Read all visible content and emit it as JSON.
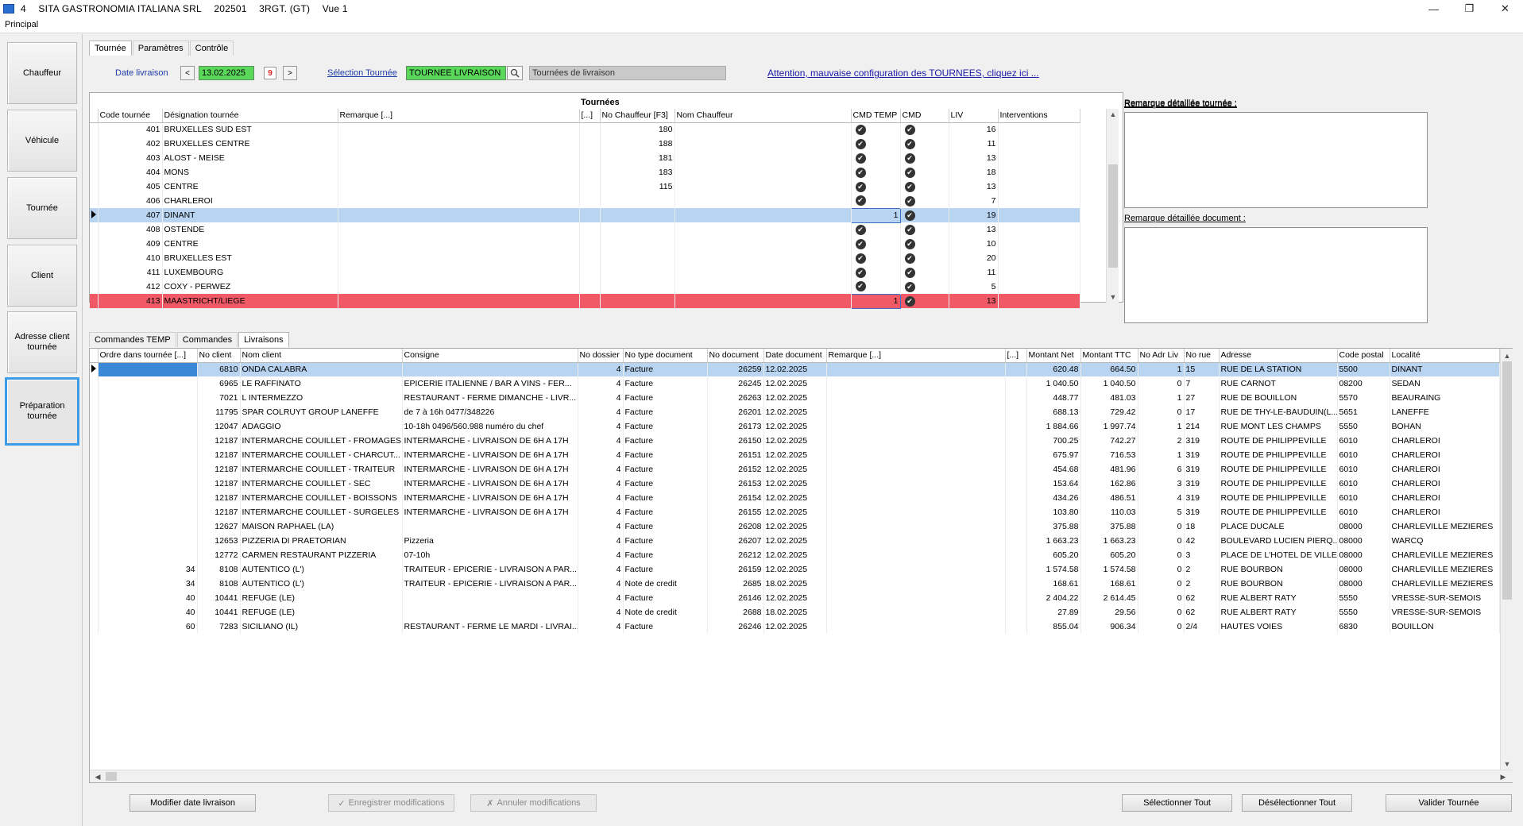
{
  "window": {
    "number": "4",
    "company": "SITA GASTRONOMIA ITALIANA SRL",
    "code": "202501",
    "region": "3RGT. (GT)",
    "view": "Vue 1"
  },
  "menu": {
    "main": "Principal"
  },
  "sidebar": {
    "items": [
      {
        "label": "Chauffeur"
      },
      {
        "label": "Véhicule"
      },
      {
        "label": "Tournée"
      },
      {
        "label": "Client"
      },
      {
        "label": "Adresse client tournée"
      },
      {
        "label": "Préparation tournée"
      }
    ]
  },
  "top_tabs": [
    {
      "label": "Tournée"
    },
    {
      "label": "Paramètres"
    },
    {
      "label": "Contrôle"
    }
  ],
  "filters": {
    "date_label": "Date livraison",
    "date_value": "13.02.2025",
    "prev": "<",
    "next": ">",
    "cal": "9",
    "selection_label": "Sélection Tournée",
    "tournee_value": "TOURNEE LIVRAISON",
    "tournee_desc": "Tournées de livraison",
    "warning": "Attention, mauvaise configuration des TOURNEES, cliquez ici ..."
  },
  "tournees": {
    "title": "Tournées",
    "columns": [
      "Code tournée",
      "Désignation tournée",
      "Remarque [...]",
      "[...]",
      "No Chauffeur [F3]",
      "Nom Chauffeur",
      "CMD TEMP",
      "CMD",
      "LIV",
      "Interventions"
    ],
    "rows": [
      {
        "code": "401",
        "name": "BRUXELLES SUD EST",
        "chauffeur": "180",
        "cmd_temp": "✔",
        "cmd": "✔",
        "liv": "16"
      },
      {
        "code": "402",
        "name": "BRUXELLES CENTRE",
        "chauffeur": "188",
        "cmd_temp": "✔",
        "cmd": "✔",
        "liv": "11"
      },
      {
        "code": "403",
        "name": "ALOST - MEISE",
        "chauffeur": "181",
        "cmd_temp": "✔",
        "cmd": "✔",
        "liv": "13"
      },
      {
        "code": "404",
        "name": "MONS",
        "chauffeur": "183",
        "cmd_temp": "✔",
        "cmd": "✔",
        "liv": "18"
      },
      {
        "code": "405",
        "name": "CENTRE",
        "chauffeur": "115",
        "cmd_temp": "✔",
        "cmd": "✔",
        "liv": "13"
      },
      {
        "code": "406",
        "name": "CHARLEROI",
        "chauffeur": "",
        "cmd_temp": "✔",
        "cmd": "✔",
        "liv": "7"
      },
      {
        "code": "407",
        "name": "DINANT",
        "chauffeur": "",
        "cmd_temp": "1",
        "cmd": "✔",
        "liv": "19"
      },
      {
        "code": "408",
        "name": "OSTENDE",
        "chauffeur": "",
        "cmd_temp": "✔",
        "cmd": "✔",
        "liv": "13"
      },
      {
        "code": "409",
        "name": "CENTRE",
        "chauffeur": "",
        "cmd_temp": "✔",
        "cmd": "✔",
        "liv": "10"
      },
      {
        "code": "410",
        "name": "BRUXELLES EST",
        "chauffeur": "",
        "cmd_temp": "✔",
        "cmd": "✔",
        "liv": "20"
      },
      {
        "code": "411",
        "name": "LUXEMBOURG",
        "chauffeur": "",
        "cmd_temp": "✔",
        "cmd": "✔",
        "liv": "11"
      },
      {
        "code": "412",
        "name": "COXY - PERWEZ",
        "chauffeur": "",
        "cmd_temp": "✔",
        "cmd": "✔",
        "liv": "5"
      },
      {
        "code": "413",
        "name": "MAASTRICHT/LIEGE",
        "chauffeur": "",
        "cmd_temp": "1",
        "cmd": "✔",
        "liv": "13"
      }
    ],
    "selected_index": 6,
    "alert_index": 12
  },
  "remarks": {
    "tournee_label": "Remarque détaillée tournée :",
    "document_label": "Remarque détaillée document :"
  },
  "bottom_tabs": [
    {
      "label": "Commandes TEMP"
    },
    {
      "label": "Commandes"
    },
    {
      "label": "Livraisons"
    }
  ],
  "livraisons": {
    "columns": [
      "Ordre dans tournée [...]",
      "No client",
      "Nom client",
      "Consigne",
      "No dossier",
      "No type document",
      "No document",
      "Date document",
      "Remarque [...]",
      "[...]",
      "Montant Net",
      "Montant TTC",
      "No Adr Liv",
      "No rue",
      "Adresse",
      "Code postal",
      "Localité"
    ],
    "rows": [
      {
        "ordre": "",
        "client": "6810",
        "nom": "ONDA CALABRA",
        "consigne": "",
        "dossier": "4",
        "type": "Facture",
        "doc": "26259",
        "date": "12.02.2025",
        "net": "620.48",
        "ttc": "664.50",
        "adr": "1",
        "rue": "15",
        "adresse": "RUE DE LA STATION",
        "cp": "5500",
        "loc": "DINANT"
      },
      {
        "ordre": "",
        "client": "6965",
        "nom": "LE RAFFINATO",
        "consigne": "EPICERIE ITALIENNE / BAR A VINS - FER...",
        "dossier": "4",
        "type": "Facture",
        "doc": "26245",
        "date": "12.02.2025",
        "net": "1 040.50",
        "ttc": "1 040.50",
        "adr": "0",
        "rue": "7",
        "adresse": "RUE CARNOT",
        "cp": "08200",
        "loc": "SEDAN"
      },
      {
        "ordre": "",
        "client": "7021",
        "nom": "L INTERMEZZO",
        "consigne": "RESTAURANT - FERME DIMANCHE - LIVR...",
        "dossier": "4",
        "type": "Facture",
        "doc": "26263",
        "date": "12.02.2025",
        "net": "448.77",
        "ttc": "481.03",
        "adr": "1",
        "rue": "27",
        "adresse": "RUE DE BOUILLON",
        "cp": "5570",
        "loc": "BEAURAING"
      },
      {
        "ordre": "",
        "client": "11795",
        "nom": "SPAR COLRUYT GROUP LANEFFE",
        "consigne": "de 7 à 16h 0477/348226",
        "dossier": "4",
        "type": "Facture",
        "doc": "26201",
        "date": "12.02.2025",
        "net": "688.13",
        "ttc": "729.42",
        "adr": "0",
        "rue": "17",
        "adresse": "RUE DE THY-LE-BAUDUIN(L...",
        "cp": "5651",
        "loc": "LANEFFE"
      },
      {
        "ordre": "",
        "client": "12047",
        "nom": "ADAGGIO",
        "consigne": "10-18h 0496/560.988 numéro du chef",
        "dossier": "4",
        "type": "Facture",
        "doc": "26173",
        "date": "12.02.2025",
        "net": "1 884.66",
        "ttc": "1 997.74",
        "adr": "1",
        "rue": "214",
        "adresse": "RUE MONT LES CHAMPS",
        "cp": "5550",
        "loc": "BOHAN"
      },
      {
        "ordre": "",
        "client": "12187",
        "nom": "INTERMARCHE COUILLET - FROMAGES",
        "consigne": "INTERMARCHE - LIVRAISON DE 6H A 17H",
        "dossier": "4",
        "type": "Facture",
        "doc": "26150",
        "date": "12.02.2025",
        "net": "700.25",
        "ttc": "742.27",
        "adr": "2",
        "rue": "319",
        "adresse": "ROUTE DE PHILIPPEVILLE",
        "cp": "6010",
        "loc": "CHARLEROI"
      },
      {
        "ordre": "",
        "client": "12187",
        "nom": "INTERMARCHE COUILLET - CHARCUT...",
        "consigne": "INTERMARCHE - LIVRAISON DE 6H A 17H",
        "dossier": "4",
        "type": "Facture",
        "doc": "26151",
        "date": "12.02.2025",
        "net": "675.97",
        "ttc": "716.53",
        "adr": "1",
        "rue": "319",
        "adresse": "ROUTE DE PHILIPPEVILLE",
        "cp": "6010",
        "loc": "CHARLEROI"
      },
      {
        "ordre": "",
        "client": "12187",
        "nom": "INTERMARCHE COUILLET - TRAITEUR",
        "consigne": "INTERMARCHE - LIVRAISON DE 6H A 17H",
        "dossier": "4",
        "type": "Facture",
        "doc": "26152",
        "date": "12.02.2025",
        "net": "454.68",
        "ttc": "481.96",
        "adr": "6",
        "rue": "319",
        "adresse": "ROUTE DE PHILIPPEVILLE",
        "cp": "6010",
        "loc": "CHARLEROI"
      },
      {
        "ordre": "",
        "client": "12187",
        "nom": "INTERMARCHE COUILLET - SEC",
        "consigne": "INTERMARCHE - LIVRAISON DE 6H A 17H",
        "dossier": "4",
        "type": "Facture",
        "doc": "26153",
        "date": "12.02.2025",
        "net": "153.64",
        "ttc": "162.86",
        "adr": "3",
        "rue": "319",
        "adresse": "ROUTE DE PHILIPPEVILLE",
        "cp": "6010",
        "loc": "CHARLEROI"
      },
      {
        "ordre": "",
        "client": "12187",
        "nom": "INTERMARCHE COUILLET - BOISSONS",
        "consigne": "INTERMARCHE - LIVRAISON DE 6H A 17H",
        "dossier": "4",
        "type": "Facture",
        "doc": "26154",
        "date": "12.02.2025",
        "net": "434.26",
        "ttc": "486.51",
        "adr": "4",
        "rue": "319",
        "adresse": "ROUTE DE PHILIPPEVILLE",
        "cp": "6010",
        "loc": "CHARLEROI"
      },
      {
        "ordre": "",
        "client": "12187",
        "nom": "INTERMARCHE COUILLET - SURGELES",
        "consigne": "INTERMARCHE - LIVRAISON DE 6H A 17H",
        "dossier": "4",
        "type": "Facture",
        "doc": "26155",
        "date": "12.02.2025",
        "net": "103.80",
        "ttc": "110.03",
        "adr": "5",
        "rue": "319",
        "adresse": "ROUTE DE PHILIPPEVILLE",
        "cp": "6010",
        "loc": "CHARLEROI"
      },
      {
        "ordre": "",
        "client": "12627",
        "nom": "MAISON RAPHAEL (LA)",
        "consigne": "",
        "dossier": "4",
        "type": "Facture",
        "doc": "26208",
        "date": "12.02.2025",
        "net": "375.88",
        "ttc": "375.88",
        "adr": "0",
        "rue": "18",
        "adresse": "PLACE DUCALE",
        "cp": "08000",
        "loc": "CHARLEVILLE MEZIERES"
      },
      {
        "ordre": "",
        "client": "12653",
        "nom": "PIZZERIA DI PRAETORIAN",
        "consigne": "Pizzeria",
        "dossier": "4",
        "type": "Facture",
        "doc": "26207",
        "date": "12.02.2025",
        "net": "1 663.23",
        "ttc": "1 663.23",
        "adr": "0",
        "rue": "42",
        "adresse": "BOULEVARD LUCIEN PIERQ...",
        "cp": "08000",
        "loc": "WARCQ"
      },
      {
        "ordre": "",
        "client": "12772",
        "nom": "CARMEN RESTAURANT PIZZERIA",
        "consigne": "07-10h",
        "dossier": "4",
        "type": "Facture",
        "doc": "26212",
        "date": "12.02.2025",
        "net": "605.20",
        "ttc": "605.20",
        "adr": "0",
        "rue": "3",
        "adresse": "PLACE DE L'HOTEL DE VILLE",
        "cp": "08000",
        "loc": "CHARLEVILLE MEZIERES"
      },
      {
        "ordre": "34",
        "client": "8108",
        "nom": "AUTENTICO (L')",
        "consigne": "TRAITEUR - EPICERIE - LIVRAISON A PAR...",
        "dossier": "4",
        "type": "Facture",
        "doc": "26159",
        "date": "12.02.2025",
        "net": "1 574.58",
        "ttc": "1 574.58",
        "adr": "0",
        "rue": "2",
        "adresse": "RUE BOURBON",
        "cp": "08000",
        "loc": "CHARLEVILLE MEZIERES"
      },
      {
        "ordre": "34",
        "client": "8108",
        "nom": "AUTENTICO (L')",
        "consigne": "TRAITEUR - EPICERIE - LIVRAISON A PAR...",
        "dossier": "4",
        "type": "Note de credit",
        "doc": "2685",
        "date": "18.02.2025",
        "net": "168.61",
        "ttc": "168.61",
        "adr": "0",
        "rue": "2",
        "adresse": "RUE BOURBON",
        "cp": "08000",
        "loc": "CHARLEVILLE MEZIERES"
      },
      {
        "ordre": "40",
        "client": "10441",
        "nom": "REFUGE (LE)",
        "consigne": "",
        "dossier": "4",
        "type": "Facture",
        "doc": "26146",
        "date": "12.02.2025",
        "net": "2 404.22",
        "ttc": "2 614.45",
        "adr": "0",
        "rue": "62",
        "adresse": "RUE ALBERT RATY",
        "cp": "5550",
        "loc": "VRESSE-SUR-SEMOIS"
      },
      {
        "ordre": "40",
        "client": "10441",
        "nom": "REFUGE (LE)",
        "consigne": "",
        "dossier": "4",
        "type": "Note de credit",
        "doc": "2688",
        "date": "18.02.2025",
        "net": "27.89",
        "ttc": "29.56",
        "adr": "0",
        "rue": "62",
        "adresse": "RUE ALBERT RATY",
        "cp": "5550",
        "loc": "VRESSE-SUR-SEMOIS"
      },
      {
        "ordre": "60",
        "client": "7283",
        "nom": "SICILIANO (IL)",
        "consigne": "RESTAURANT - FERME LE MARDI - LIVRAI...",
        "dossier": "4",
        "type": "Facture",
        "doc": "26246",
        "date": "12.02.2025",
        "net": "855.04",
        "ttc": "906.34",
        "adr": "0",
        "rue": "2/4",
        "adresse": "HAUTES VOIES",
        "cp": "6830",
        "loc": "BOUILLON"
      }
    ]
  },
  "buttons": {
    "modifier_date": "Modifier date livraison",
    "enregistrer": "Enregistrer modifications",
    "annuler": "Annuler modifications",
    "select_all": "Sélectionner Tout",
    "deselect_all": "Désélectionner Tout",
    "valider": "Valider Tournée"
  },
  "colors": {
    "green_field": "#5ad85a",
    "selected_row": "#b8d4f0",
    "alert_row": "#ef5a66",
    "active_nav_border": "#3c9ce8"
  }
}
